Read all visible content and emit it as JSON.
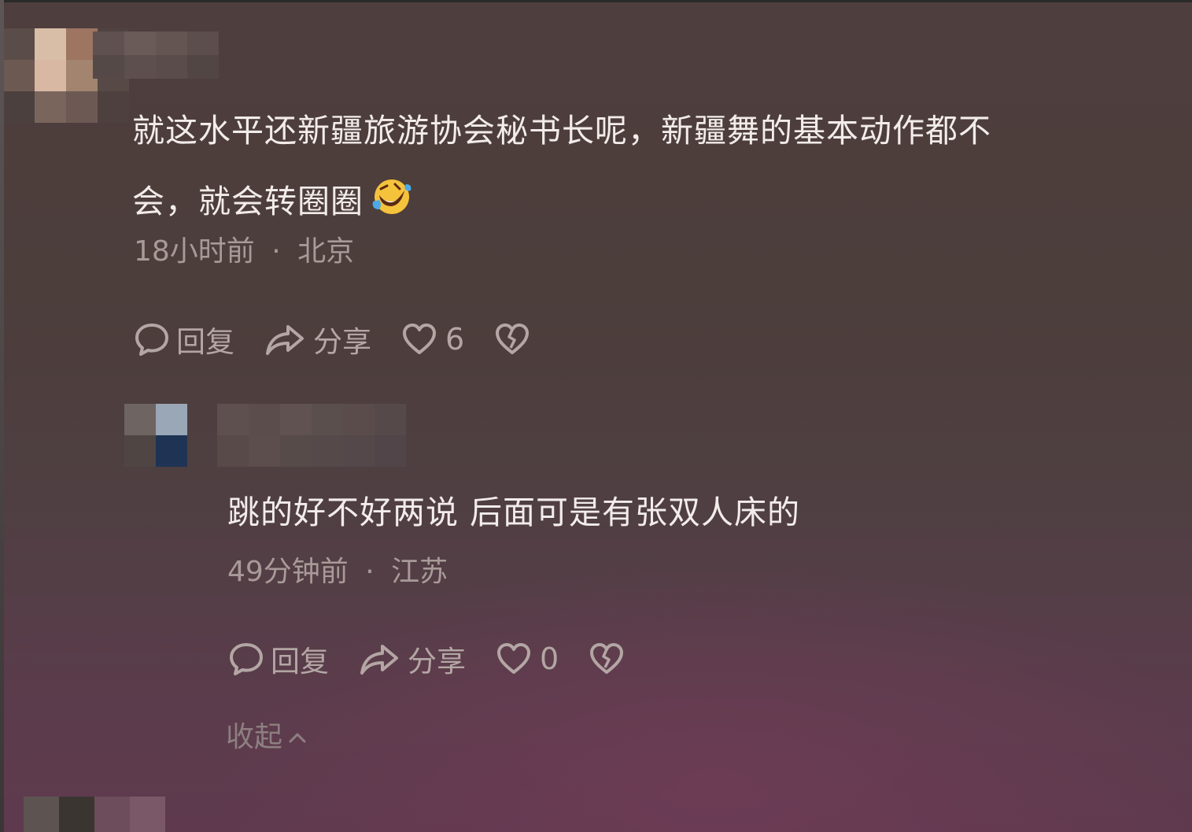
{
  "comments": [
    {
      "text_lines": [
        "就这水平还新疆旅游协会秘书长呢，新疆舞的基本动作都不",
        "会，就会转圈圈"
      ],
      "emoji": "rolling-on-floor-laughing-emoji",
      "time": "18小时前",
      "separator": "·",
      "location": "北京",
      "reply_label": "回复",
      "share_label": "分享",
      "like_count": "6"
    },
    {
      "text_lines": [
        "跳的好不好两说 后面可是有张双人床的"
      ],
      "time": "49分钟前",
      "separator": "·",
      "location": "江苏",
      "reply_label": "回复",
      "share_label": "分享",
      "like_count": "0"
    }
  ],
  "collapse_label": "收起",
  "icons": {
    "reply": "comment-bubble-icon",
    "share": "share-arrow-icon",
    "like": "heart-icon",
    "dislike": "broken-heart-icon",
    "collapse": "chevron-up-icon"
  },
  "colors": {
    "text": "#f2ecea",
    "meta": "#a89a98",
    "action": "#b3a6a4",
    "collapse": "#8e7f80"
  }
}
